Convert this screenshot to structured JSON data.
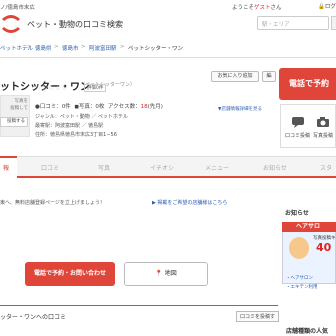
{
  "header": {
    "region": "ノ/徳島市末広",
    "site_title": "ペット・動物の口コミ検索",
    "welcome_prefix": "ようこそ",
    "welcome_name": "ゲスト",
    "welcome_suffix": "さん",
    "login": "ログ",
    "search_placeholder": "駅・エリア"
  },
  "breadcrumb": [
    "ペットホテル",
    "徳島県",
    "徳島市",
    "阿波富田駅",
    "ペットシッター・ワン"
  ],
  "shop": {
    "name": "ットシッター・ワン",
    "kana": "（ペットシッターワン）",
    "fav_button": "お気に入り追加",
    "edit_button": "編",
    "tel_button": "電話で予約",
    "eval_label": "評価0件",
    "info_link": "▼店舗情報詳細を見る",
    "photo_text": "写真を\n投稿して",
    "photo_button": "投稿する",
    "reviews": "口コミ：0件",
    "photos": "写真：0枚",
    "access_label": "アクセス数：",
    "access_count": "18",
    "access_suffix": "(先月)",
    "genre": "ジャンル：ペット・動物 ／ ペットホテル",
    "nearest": "最寄駅：阿波富田駅 ／ 徳島駅",
    "address": "住所：徳島県徳島市末広3丁目1−56",
    "side_review": "口コミ投稿",
    "side_photo": "写真投稿"
  },
  "tabs": [
    "口コミ",
    "写真",
    "イチオシ",
    "メニュー",
    "お知らせ",
    "スタ"
  ],
  "tab_active": "報",
  "notice": "東へ、無料店舗登録ページを立上げましょう！",
  "notice_link": "▶ 掲載をご希望の店舗様はこちら",
  "sidebar": {
    "oshirase": "お知らせ",
    "banner_top": "ヘアサロ",
    "banner_line1": "写真投稿キ",
    "banner_num": "40",
    "bullet1": "・ヘアサロン",
    "bullet2": "・エキテン利用",
    "popular": "店舗種類の人気"
  },
  "actions": {
    "tel": "電話で予約・お問い合わせ",
    "map": "地図"
  },
  "review_section": {
    "title": "ッター・ワンへの口コミ",
    "post": "口コミを投稿す"
  }
}
